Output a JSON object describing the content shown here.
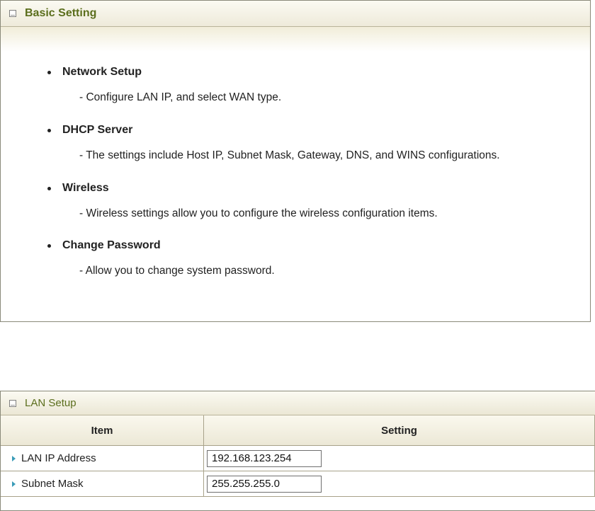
{
  "basic_setting": {
    "title": "Basic Setting",
    "topics": [
      {
        "title": "Network Setup",
        "desc": "- Configure LAN IP, and select WAN type."
      },
      {
        "title": "DHCP Server",
        "desc": "- The settings include Host IP, Subnet Mask, Gateway, DNS, and WINS configurations."
      },
      {
        "title": "Wireless",
        "desc": "- Wireless settings allow you to configure the wireless configuration items."
      },
      {
        "title": "Change Password",
        "desc": "- Allow you to change system password."
      }
    ]
  },
  "lan_setup": {
    "title": "LAN Setup",
    "columns": {
      "item": "Item",
      "setting": "Setting"
    },
    "rows": [
      {
        "label": "LAN IP Address",
        "value": "192.168.123.254"
      },
      {
        "label": "Subnet Mask",
        "value": "255.255.255.0"
      }
    ]
  }
}
